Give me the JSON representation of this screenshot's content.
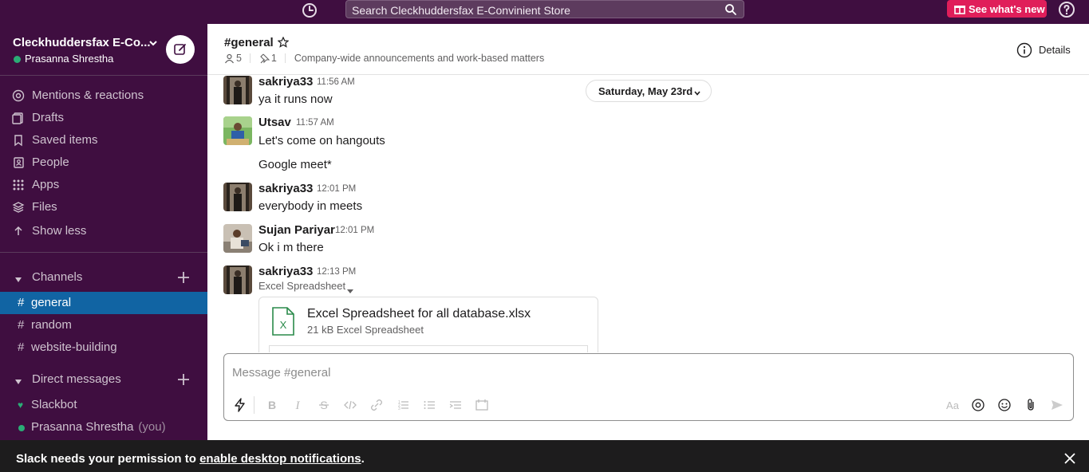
{
  "search": {
    "placeholder": "Search Cleckhuddersfax E-Convinient Store"
  },
  "whats_new": {
    "label": "See what's new"
  },
  "workspace": {
    "name": "Cleckhuddersfax E-Co...",
    "user": "Prasanna Shrestha"
  },
  "nav": [
    {
      "label": "Mentions & reactions",
      "icon": "at-icon"
    },
    {
      "label": "Drafts",
      "icon": "drafts-icon"
    },
    {
      "label": "Saved items",
      "icon": "bookmark-icon"
    },
    {
      "label": "People",
      "icon": "people-icon"
    },
    {
      "label": "Apps",
      "icon": "apps-grid-icon"
    },
    {
      "label": "Files",
      "icon": "layers-icon"
    },
    {
      "label": "Show less",
      "icon": "arrow-up-icon"
    }
  ],
  "channels": {
    "title": "Channels",
    "items": [
      {
        "name": "general",
        "active": true
      },
      {
        "name": "random",
        "active": false
      },
      {
        "name": "website-building",
        "active": false
      }
    ]
  },
  "dms": {
    "title": "Direct messages",
    "items": [
      {
        "name": "Slackbot",
        "suffix": ""
      },
      {
        "name": "Prasanna Shrestha",
        "suffix": "(you)"
      }
    ]
  },
  "channel": {
    "title": "#general",
    "members": "5",
    "pinned": "1",
    "topic": "Company-wide announcements and work-based matters",
    "details_label": "Details"
  },
  "date_divider": "Saturday, May 23rd",
  "messages": [
    {
      "author": "sakriya33",
      "time": "11:56 AM",
      "text": "ya it runs now"
    },
    {
      "author": "Utsav",
      "time": "11:57 AM",
      "text": "Let's come on hangouts"
    },
    {
      "text": "Google meet*"
    },
    {
      "author": "sakriya33",
      "time": "12:01 PM",
      "text": "everybody in meets"
    },
    {
      "author": "Sujan Pariyar",
      "time": "12:01 PM",
      "text": "Ok i m there"
    },
    {
      "author": "sakriya33",
      "time": "12:13 PM",
      "text": "Excel Spreadsheet"
    }
  ],
  "file": {
    "icon_letter": "X",
    "name": "Excel Spreadsheet for all database.xlsx",
    "meta": "21 kB Excel Spreadsheet"
  },
  "composer": {
    "placeholder": "Message #general",
    "format_label": "Aa"
  },
  "notification": {
    "text_before": "Slack needs your permission to ",
    "link": "enable desktop notifications",
    "text_after": "."
  },
  "colors": {
    "sidebar": "#3f0e40",
    "active_channel": "#1164a3",
    "presence": "#2bac76",
    "whats_new": "#e01e5a",
    "notification_bar": "#1d1c1d"
  }
}
